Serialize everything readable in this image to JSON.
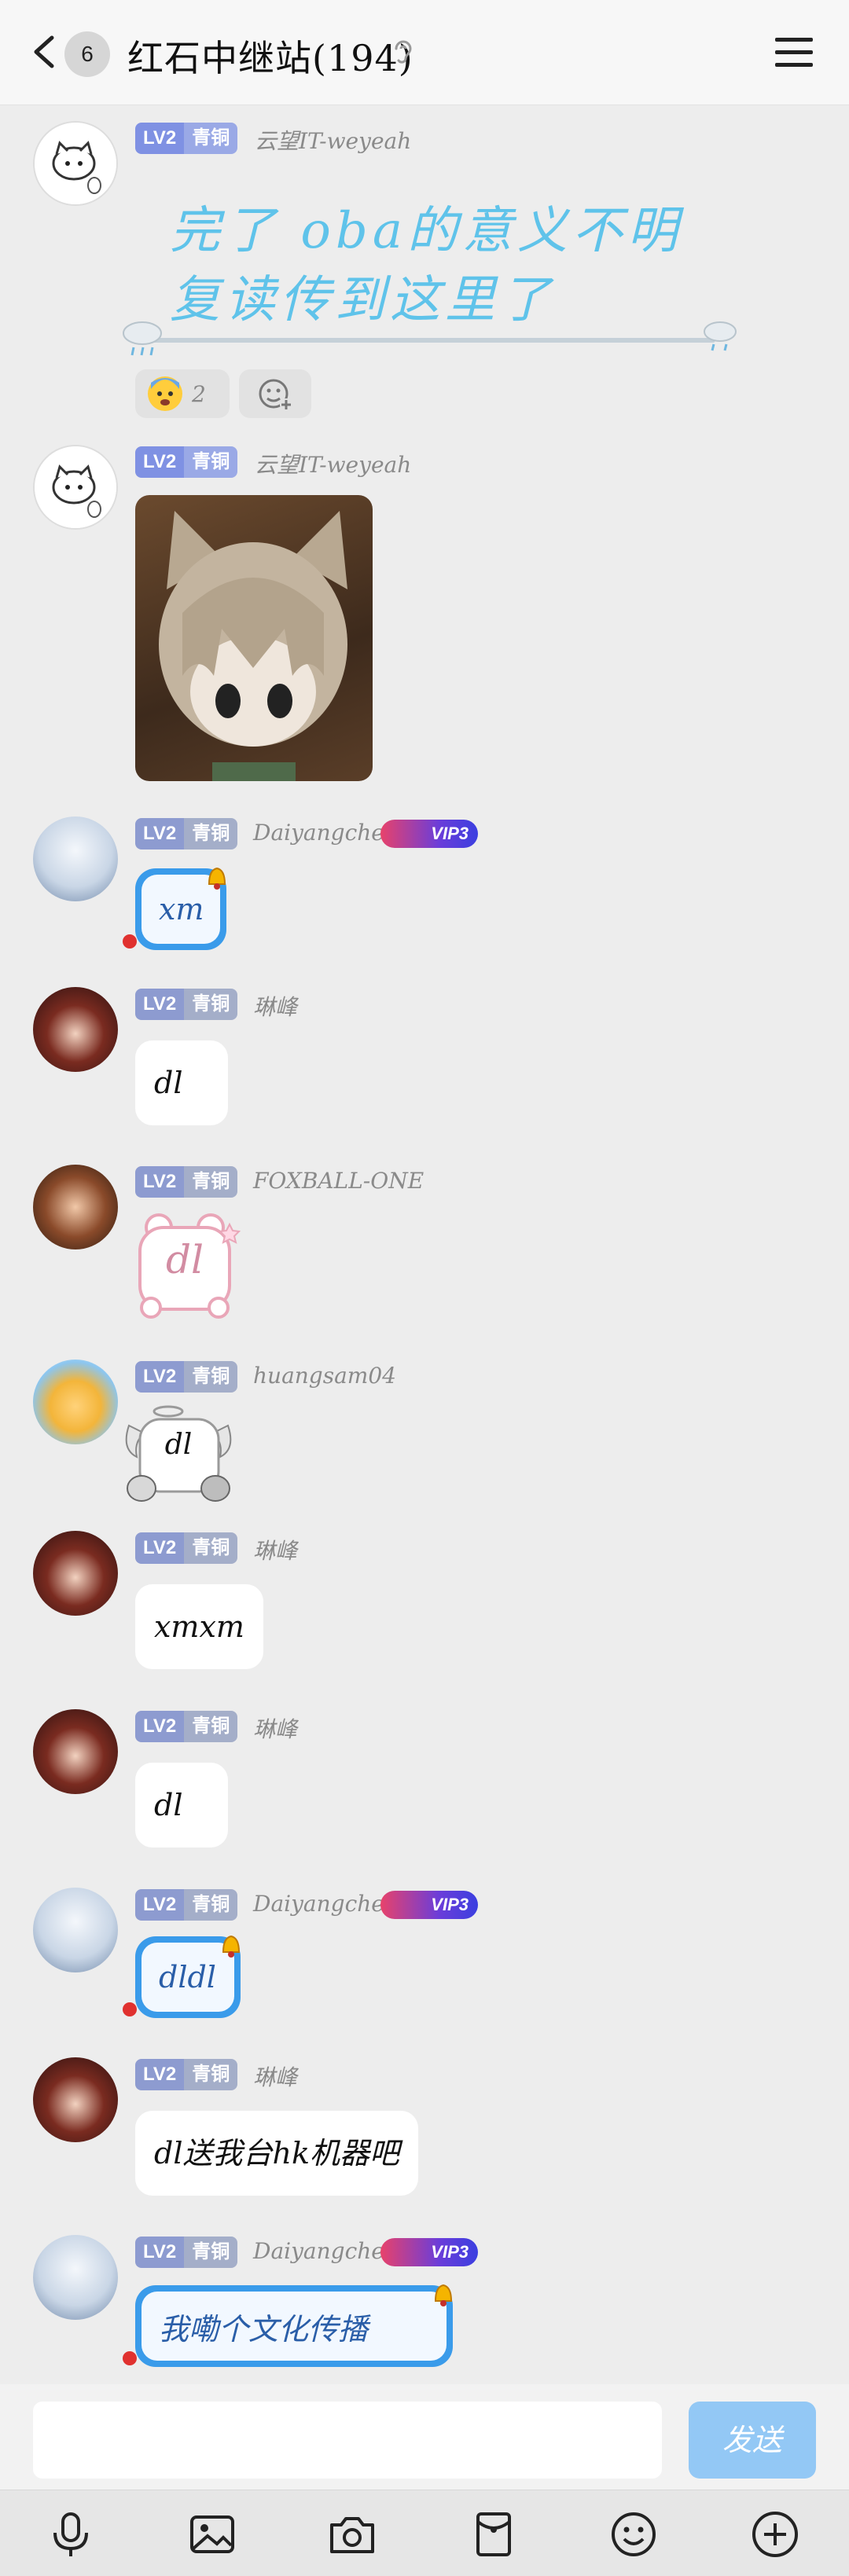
{
  "header": {
    "unread_count": "6",
    "title": "红石中继站(194)"
  },
  "badge": {
    "level": "LV2",
    "rank": "青铜"
  },
  "vip_label": "VIP3",
  "messages": [
    {
      "nick": "云望IT-weyeah",
      "line1": "完了 oba的意义不明",
      "line2": "复读传到这里了",
      "reaction_count": "2"
    },
    {
      "nick": "云望IT-weyeah"
    },
    {
      "nick": "Daiyangcheng",
      "text": "xm"
    },
    {
      "nick": "琳峰",
      "text": "dl"
    },
    {
      "nick": "FOXBALL-ONE",
      "text": "dl"
    },
    {
      "nick": "huangsam04",
      "text": "dl"
    },
    {
      "nick": "琳峰",
      "text": "xmxm"
    },
    {
      "nick": "琳峰",
      "text": "dl"
    },
    {
      "nick": "Daiyangcheng",
      "text": "dldl"
    },
    {
      "nick": "琳峰",
      "text": "dl送我台hk机器吧"
    },
    {
      "nick": "Daiyangcheng",
      "text": "我嘞个文化传播"
    }
  ],
  "input": {
    "placeholder": "",
    "send_label": "发送"
  },
  "toolbar": [
    "microphone-icon",
    "image-icon",
    "camera-icon",
    "red-packet-icon",
    "emoji-icon",
    "plus-icon"
  ],
  "colors": {
    "vip_bubble": "#3a9bea",
    "send_button": "#93c8f5",
    "big_text": "#5fc3ea",
    "badge": "#8d9bd0"
  }
}
